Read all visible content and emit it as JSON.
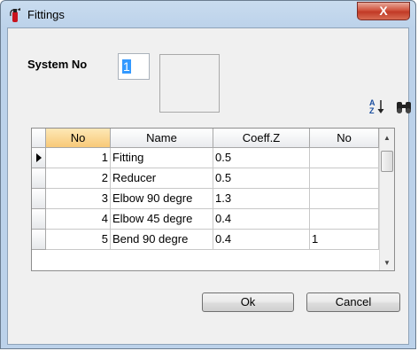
{
  "window": {
    "title": "Fittings",
    "close_label": "X"
  },
  "system": {
    "label": "System No",
    "value": "1"
  },
  "toolbar": {
    "sort_icon": "sort-az-icon",
    "find_icon": "binoculars-icon"
  },
  "grid": {
    "columns": [
      "No",
      "Name",
      "Coeff.Z",
      "No"
    ],
    "rows": [
      [
        "1",
        "Fitting",
        "0.5",
        ""
      ],
      [
        "2",
        "Reducer",
        "0.5",
        ""
      ],
      [
        "3",
        "Elbow 90 degre",
        "1.3",
        ""
      ],
      [
        "4",
        "Elbow 45 degre",
        "0.4",
        ""
      ],
      [
        "5",
        "Bend 90 degre",
        "0.4",
        "1"
      ]
    ],
    "current_row": 0
  },
  "buttons": {
    "ok": "Ok",
    "cancel": "Cancel"
  },
  "colors": {
    "selection": "#3399ff",
    "header_highlight": "#f8c978"
  }
}
